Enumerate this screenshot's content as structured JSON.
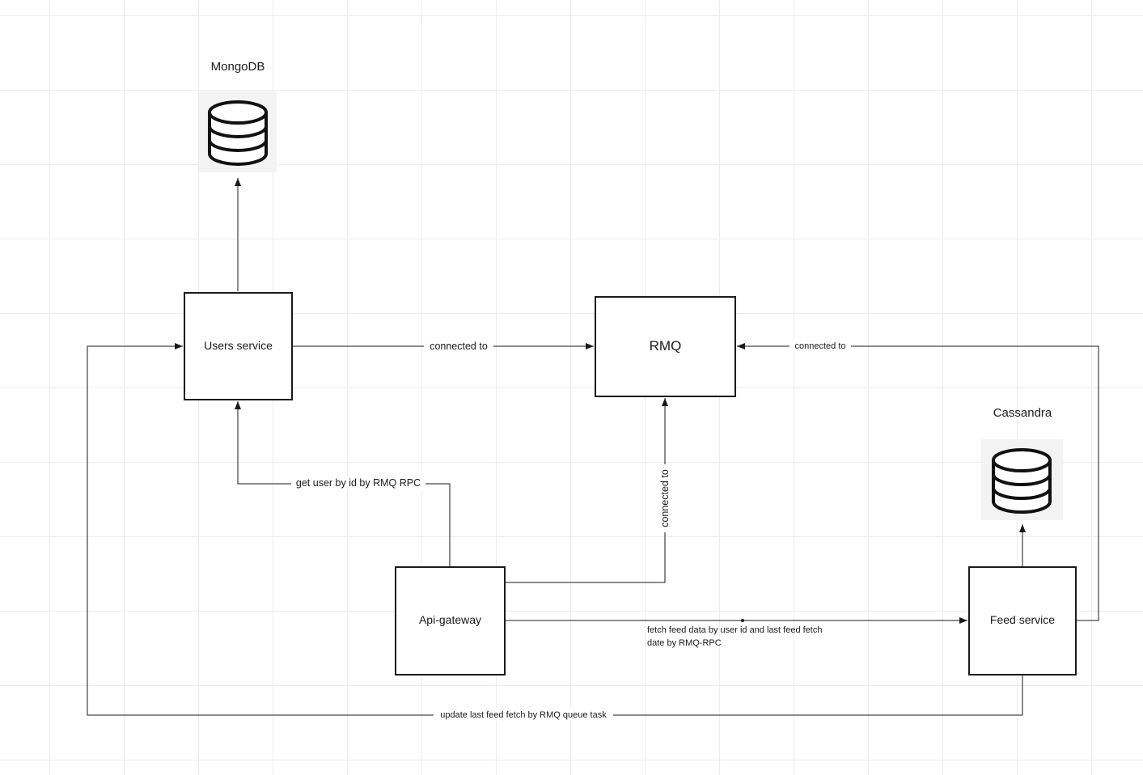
{
  "nodes": {
    "users_service": "Users service",
    "rmq": "RMQ",
    "api_gateway": "Api-gateway",
    "feed_service": "Feed service"
  },
  "databases": {
    "mongodb": "MongoDB",
    "cassandra": "Cassandra"
  },
  "edges": {
    "users_to_rmq": "connected to",
    "feed_to_rmq": "connected to",
    "api_to_rmq": "connected to",
    "api_to_users": "get user by id by RMQ RPC",
    "api_to_feed_line1": "fetch feed data by user id and last feed fetch",
    "api_to_feed_line2": "date by RMQ-RPC",
    "feed_to_users": "update last feed fetch by RMQ queue task"
  },
  "icons": {
    "database": "database-icon"
  },
  "colors": {
    "stroke": "#1a1a1a",
    "grid": "#ececec",
    "background": "#ffffff"
  }
}
